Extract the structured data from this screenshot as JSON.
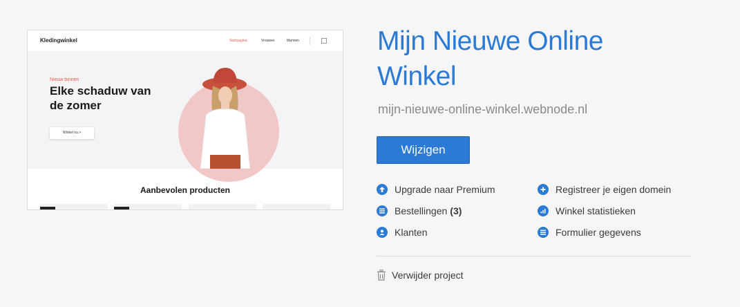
{
  "preview": {
    "logo": "Kledingwinkel",
    "menu": [
      "Startpagina",
      "Vrouwen",
      "Mannen"
    ],
    "eyebrow": "Nieuw binnen",
    "hero_title": "Elke schaduw van de zomer",
    "hero_button": "Winkel nu  >",
    "section_title": "Aanbevolen producten",
    "accent_color": "#e8604c"
  },
  "project": {
    "title": "Mijn Nieuwe Online Winkel",
    "url": "mijn-nieuwe-online-winkel.webnode.nl",
    "edit_label": "Wijzigen"
  },
  "actions": {
    "upgrade": {
      "label": "Upgrade naar Premium",
      "icon": "arrow-up-icon"
    },
    "orders": {
      "label": "Bestellingen",
      "count": "(3)",
      "icon": "list-icon"
    },
    "customers": {
      "label": "Klanten",
      "icon": "user-icon"
    },
    "domain": {
      "label": "Registreer je eigen domein",
      "icon": "plus-icon"
    },
    "stats": {
      "label": "Winkel statistieken",
      "icon": "bar-chart-icon"
    },
    "forms": {
      "label": "Formulier gegevens",
      "icon": "list-icon"
    }
  },
  "delete_label": "Verwijder project",
  "colors": {
    "primary": "#2a7ad6",
    "background": "#f6f6f6"
  }
}
